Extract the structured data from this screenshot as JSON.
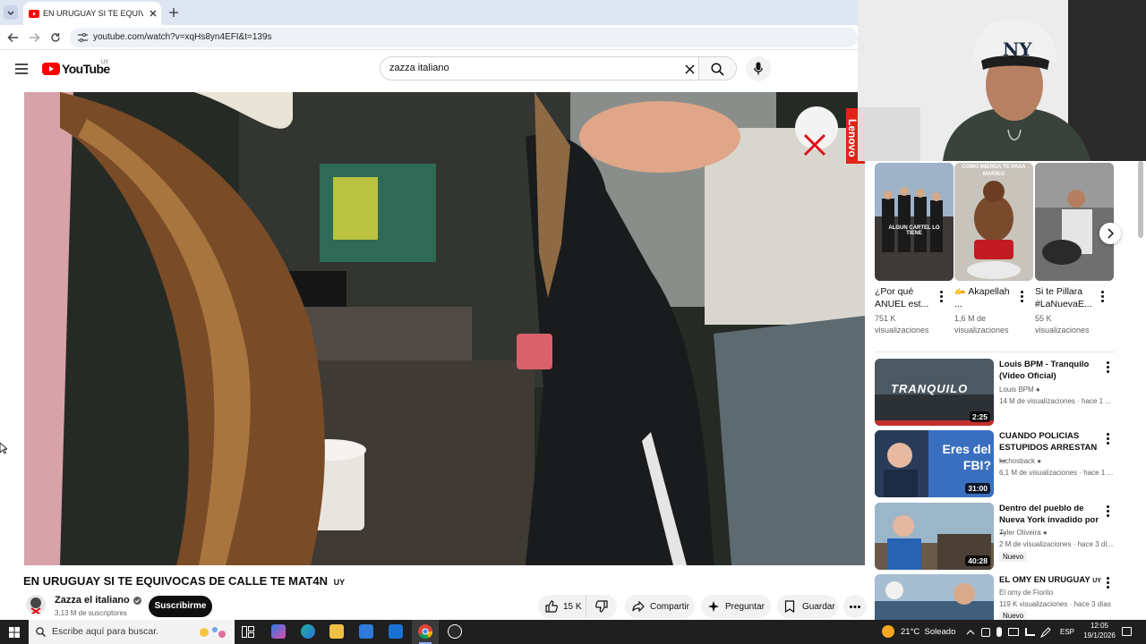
{
  "browser": {
    "tab_title": "EN URUGUAY SI TE EQUIVOCAS",
    "url": "youtube.com/watch?v=xqHs8yn4EFI&t=139s"
  },
  "youtube": {
    "logo_text": "YouTube",
    "region": "UY",
    "search_query": "zazza italiano"
  },
  "video": {
    "title": "EN URUGUAY SI TE EQUIVOCAS DE CALLE TE MAT4N",
    "title_flag": "UY",
    "overlay_brand": "Lenovo",
    "channel_name": "Zazza el italiano",
    "subscribers": "3,13 M de suscriptores",
    "subscribe_label": "Suscribirme",
    "likes": "15 K",
    "share_label": "Compartir",
    "ask_label": "Preguntar",
    "save_label": "Guardar"
  },
  "shorts": [
    {
      "title": "¿Por qué ANUEL est...",
      "views": "751 K visualizaciones",
      "thumb_text": "ALGUN CARTEL LO TIENE"
    },
    {
      "title": "🫴 Akapellah ...",
      "views": "1,6 M de visualizaciones",
      "thumb_text": "COMO MIERDA TE PASA MARIKO"
    },
    {
      "title": "Si te Pillara #LaNuevaE...",
      "views": "55 K visualizaciones",
      "thumb_text": ""
    }
  ],
  "related": [
    {
      "title": "Louis BPM - Tranquilo (Video Oficial)",
      "channel": "Louis BPM",
      "meta": "14 M de visualizaciones · hace 1 ...",
      "duration": "2:25",
      "thumb_text": "TRANQUILO",
      "badge": ""
    },
    {
      "title": "CUANDO POLICIAS ESTUPIDOS ARRESTAN ...",
      "channel": "luchosback",
      "meta": "6,1 M de visualizaciones · hace 1 ...",
      "duration": "31:00",
      "thumb_text": "Eres del FBI?",
      "badge": ""
    },
    {
      "title": "Dentro del pueblo de Nueva York invadido por ...",
      "channel": "Tyler Oliveira",
      "meta": "2 M de visualizaciones · hace 3 dí...",
      "duration": "40:28",
      "thumb_text": "",
      "badge": "Nuevo"
    },
    {
      "title": "EL OMY EN URUGUAY",
      "title_flag": "UY",
      "channel": "El omy de Fiorito",
      "meta": "119 K visualizaciones · hace 3 días",
      "duration": "",
      "thumb_text": "",
      "badge": "Nuevo"
    }
  ],
  "taskbar": {
    "search_placeholder": "Escribe aquí para buscar.",
    "weather": "21°C  Soleado",
    "lang": "ESP",
    "time": "12:05",
    "date": "19/1/2026"
  },
  "colors": {
    "yt_red": "#ff0000",
    "tab_bg": "#dfe6f3",
    "taskbar": "#1f1f1f"
  }
}
